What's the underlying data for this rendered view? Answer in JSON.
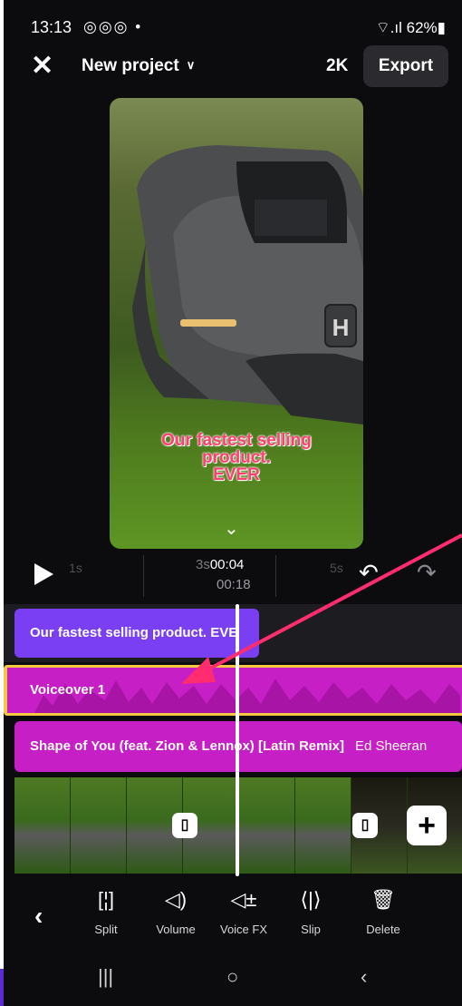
{
  "status_bar": {
    "time": "13:13",
    "app_icons": "◎◎◎ •",
    "right": "⌔.ıl 62%▮"
  },
  "top_bar": {
    "title": "New project",
    "resolution": "2K",
    "export_label": "Export"
  },
  "preview": {
    "caption_line1": "Our fastest selling",
    "caption_line2": "product.",
    "caption_line3": "EVER"
  },
  "timeline": {
    "tick_1s": "1s",
    "tick_3s": "3s",
    "tick_5s": "5s",
    "current_time": "00:04",
    "total_time": "00:18"
  },
  "tracks": {
    "title_clip": "Our fastest selling product. EVE",
    "voiceover_clip": "Voiceover 1",
    "music_title": "Shape of You (feat. Zion & Lennox) [Latin Remix]",
    "music_artist": "Ed Sheeran"
  },
  "toolbar": {
    "items": [
      {
        "label": "Split",
        "icon": "split-icon"
      },
      {
        "label": "Volume",
        "icon": "volume-icon"
      },
      {
        "label": "Voice FX",
        "icon": "voice-fx-icon"
      },
      {
        "label": "Slip",
        "icon": "slip-icon"
      },
      {
        "label": "Delete",
        "icon": "delete-icon"
      }
    ]
  },
  "colors": {
    "title_track": "#7a3ff2",
    "audio_track": "#c71fc6",
    "selection": "#f5c842",
    "annotation_arrow": "#ff2d6f"
  }
}
